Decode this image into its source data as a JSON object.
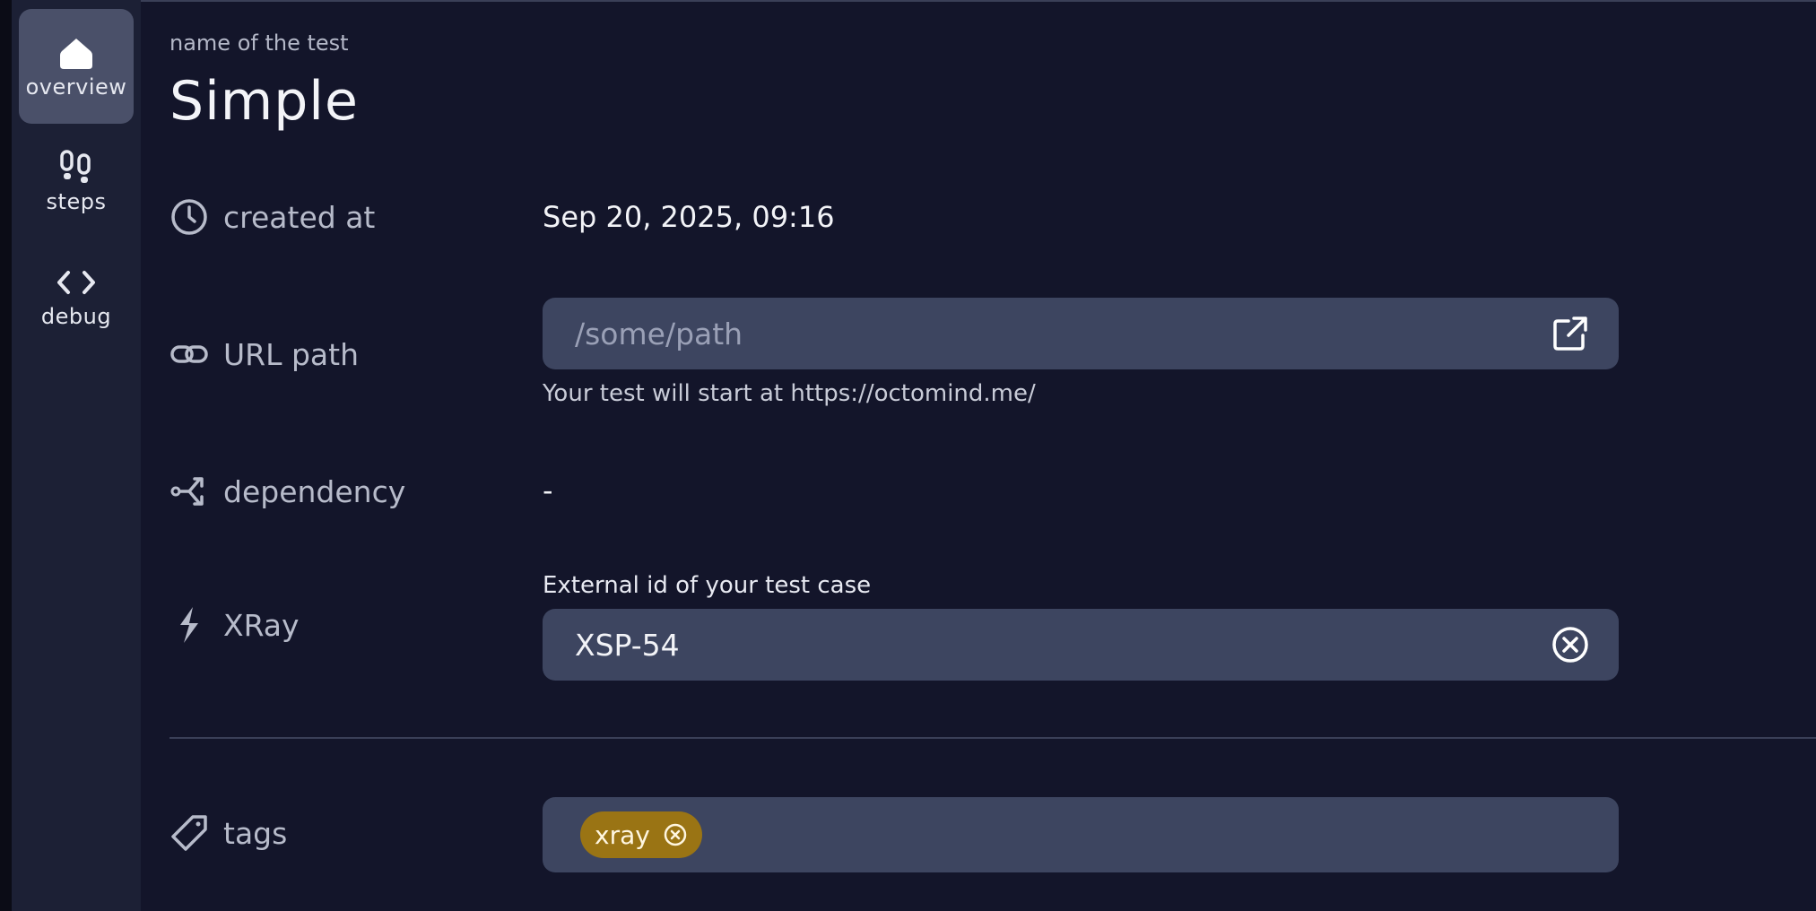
{
  "sidebar": {
    "items": [
      {
        "label": "overview",
        "icon": "home-icon",
        "active": true
      },
      {
        "label": "steps",
        "icon": "footsteps-icon",
        "active": false
      },
      {
        "label": "debug",
        "icon": "code-icon",
        "active": false
      }
    ]
  },
  "header": {
    "caption": "name of the test",
    "title": "Simple"
  },
  "fields": {
    "created_at": {
      "label": "created at",
      "icon": "clock-icon",
      "value": "Sep 20, 2025, 09:16"
    },
    "url_path": {
      "label": "URL path",
      "icon": "link-icon",
      "value": "",
      "placeholder": "/some/path",
      "helper": "Your test will start at https://octomind.me/",
      "action_icon": "external-link-icon"
    },
    "dependency": {
      "label": "dependency",
      "icon": "branch-icon",
      "value": "-"
    },
    "xray": {
      "label": "XRay",
      "icon": "lightning-icon",
      "caption": "External id of your test case",
      "value": "XSP-54",
      "action_icon": "clear-circle-icon"
    },
    "tags": {
      "label": "tags",
      "icon": "tag-icon",
      "items": [
        {
          "label": "xray",
          "color": "#9a7414"
        }
      ]
    }
  },
  "colors": {
    "background": "#13152a",
    "sidebar": "#1c2035",
    "input": "#3d4560",
    "tag": "#9a7414"
  }
}
